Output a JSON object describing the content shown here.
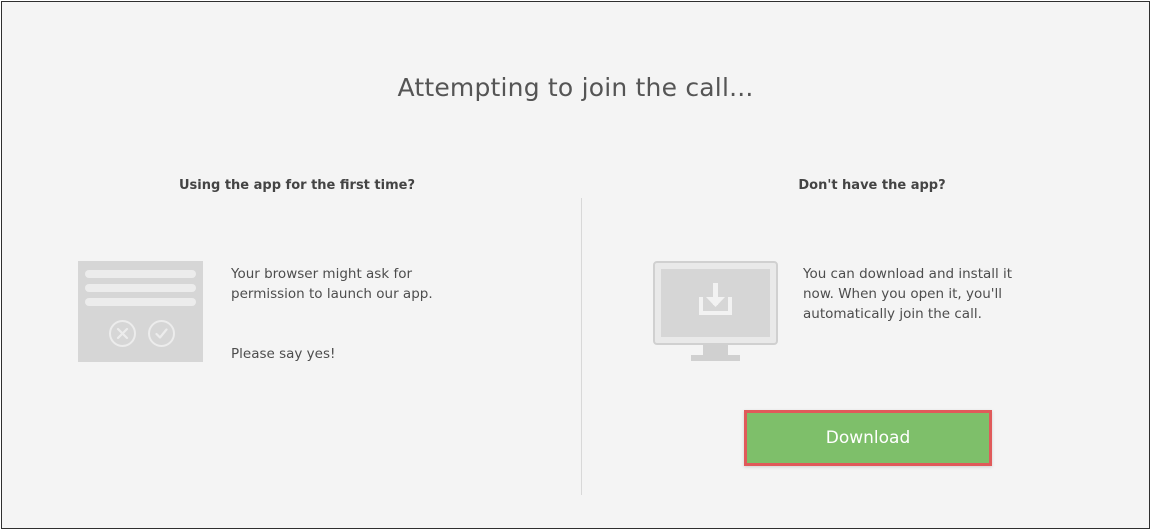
{
  "page": {
    "title": "Attempting to join the call..."
  },
  "left_column": {
    "heading": "Using the app for the first time?",
    "line1": "Your browser might ask for",
    "line2": "permission to launch our app.",
    "line3": "Please say yes!",
    "illustration_icons": [
      "close-circle-icon",
      "check-circle-icon"
    ]
  },
  "right_column": {
    "heading": "Don't have the app?",
    "line1": "You can download and install it",
    "line2": "now. When you open it, you'll",
    "line3": "automatically join the call.",
    "illustration_icon": "monitor-download-icon",
    "download_label": "Download"
  },
  "colors": {
    "background": "#f4f4f4",
    "button_green": "#7ebf6a",
    "highlight_red": "#e05a5a",
    "illustration_gray": "#d6d6d6"
  }
}
